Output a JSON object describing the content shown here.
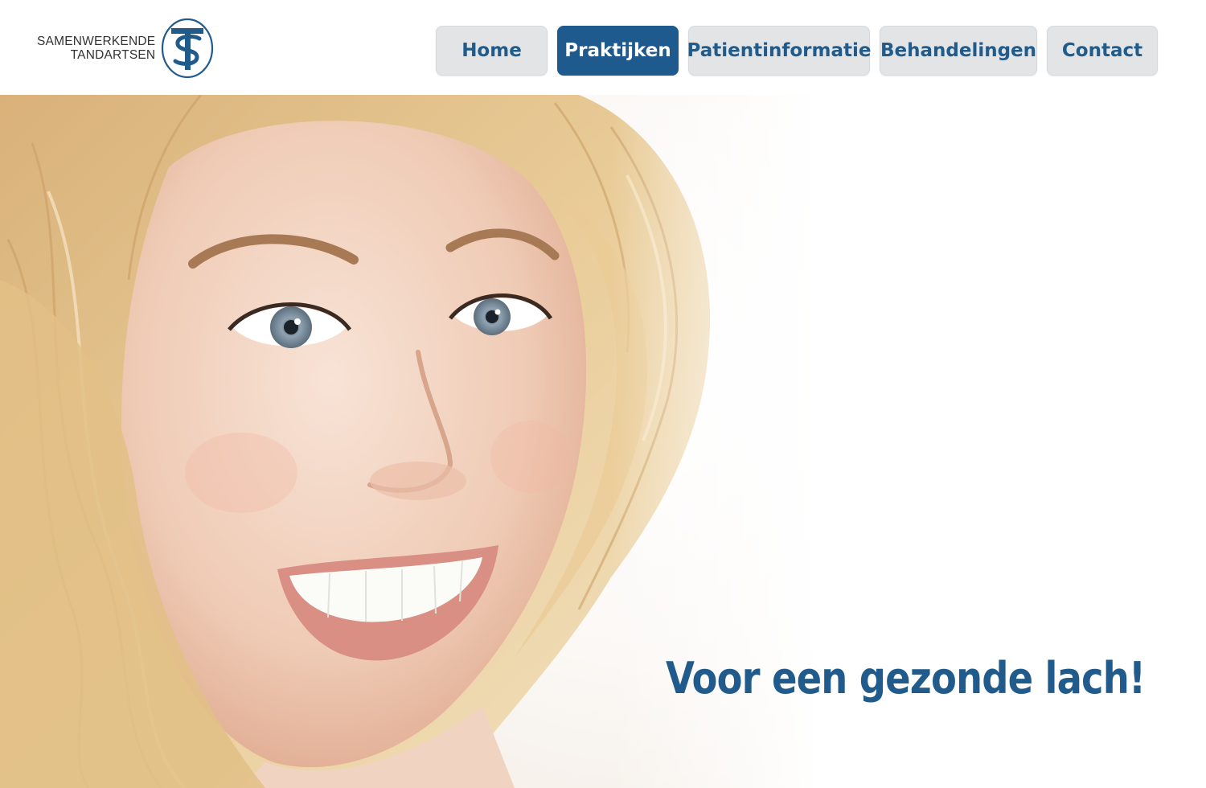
{
  "logo": {
    "line1": "SAMENWERKENDE",
    "line2": "TANDARTSEN"
  },
  "nav": {
    "items": [
      {
        "label": "Home",
        "active": false
      },
      {
        "label": "Praktijken",
        "active": true
      },
      {
        "label": "Patientinformatie",
        "active": false
      },
      {
        "label": "Behandelingen",
        "active": false
      },
      {
        "label": "Contact",
        "active": false
      }
    ]
  },
  "hero": {
    "tagline": "Voor een gezonde lach!",
    "image": "smiling-woman-photo"
  },
  "colors": {
    "brand_blue": "#205b8c",
    "nav_bg": "#e3e4e6",
    "active_bg": "#1f5a8e"
  }
}
